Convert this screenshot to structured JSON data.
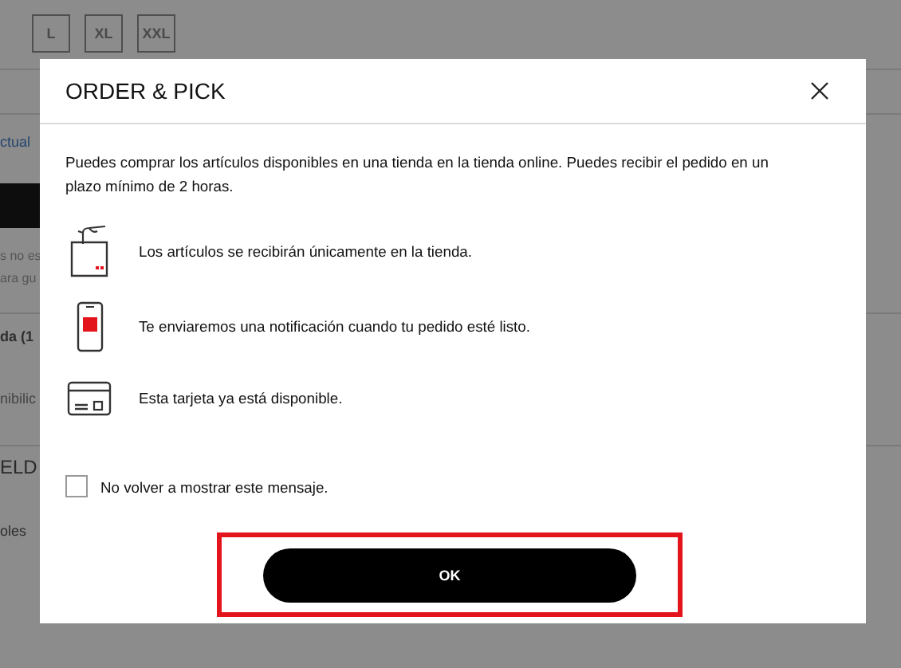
{
  "background": {
    "size_buttons": [
      "L",
      "XL",
      "XXL"
    ],
    "link": "ctual",
    "notes": [
      "s no es",
      "ara gu"
    ],
    "section_title": "da  (1",
    "availability": "nibilic",
    "product_title": "ELD",
    "footer_text": "oles"
  },
  "dialog": {
    "title": "ORDER & PICK",
    "intro": "Puedes comprar los artículos disponibles en una tienda en la tienda online. Puedes recibir el pedido en un plazo mínimo de 2 horas.",
    "features": [
      {
        "kind": "bag",
        "text": "Los artículos se recibirán únicamente en la tienda."
      },
      {
        "kind": "phone",
        "text": "Te enviaremos una notificación cuando tu pedido esté listo."
      },
      {
        "kind": "card",
        "text": "Esta tarjeta ya está disponible."
      }
    ],
    "dont_show_again": {
      "label": "No volver a mostrar este mensaje.",
      "checked": false
    },
    "ok_button": "OK"
  }
}
